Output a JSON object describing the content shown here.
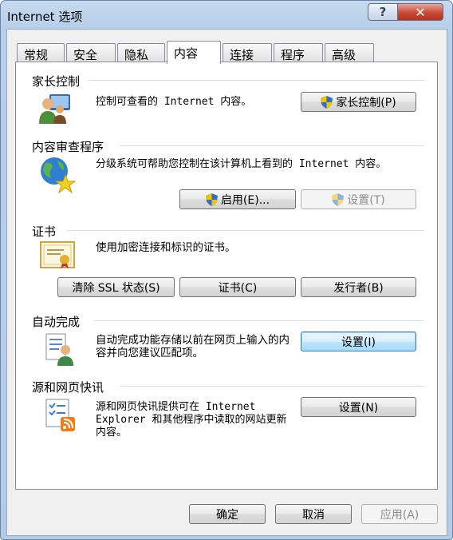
{
  "window": {
    "title": "Internet 选项",
    "help_glyph": "?",
    "close_glyph": "✕"
  },
  "tabs": [
    {
      "label": "常规"
    },
    {
      "label": "安全"
    },
    {
      "label": "隐私"
    },
    {
      "label": "内容",
      "active": true
    },
    {
      "label": "连接"
    },
    {
      "label": "程序"
    },
    {
      "label": "高级"
    }
  ],
  "parental": {
    "title": "家长控制",
    "description": "控制可查看的 Internet 内容。",
    "button": "家长控制(P)",
    "icon": "parental-control-users-icon"
  },
  "advisor": {
    "title": "内容审查程序",
    "description": "分级系统可帮助您控制在该计算机上看到的 Internet 内容。",
    "enable_button": "启用(E)...",
    "settings_button": "设置(T)",
    "icon": "globe-star-icon"
  },
  "certificates": {
    "title": "证书",
    "description": "使用加密连接和标识的证书。",
    "clear_ssl_button": "清除 SSL 状态(S)",
    "certificates_button": "证书(C)",
    "publishers_button": "发行者(B)",
    "icon": "certificate-icon"
  },
  "autocomplete": {
    "title": "自动完成",
    "description": "自动完成功能存储以前在网页上输入的内容并向您建议匹配项。",
    "settings_button": "设置(I)",
    "icon": "autocomplete-user-icon"
  },
  "feeds": {
    "title": "源和网页快讯",
    "description": "源和网页快讯提供可在 Internet Explorer 和其他程序中读取的网站更新内容。",
    "settings_button": "设置(N)",
    "icon": "rss-feed-icon"
  },
  "footer": {
    "ok_button": "确定",
    "cancel_button": "取消",
    "apply_button": "应用(A)"
  },
  "colors": {
    "title_bar": "#b8cfe9",
    "close_button": "#c84a34",
    "focus_button": "#3c7fb1",
    "shield_blue": "#2f6fc8",
    "shield_yellow": "#f2c200"
  }
}
